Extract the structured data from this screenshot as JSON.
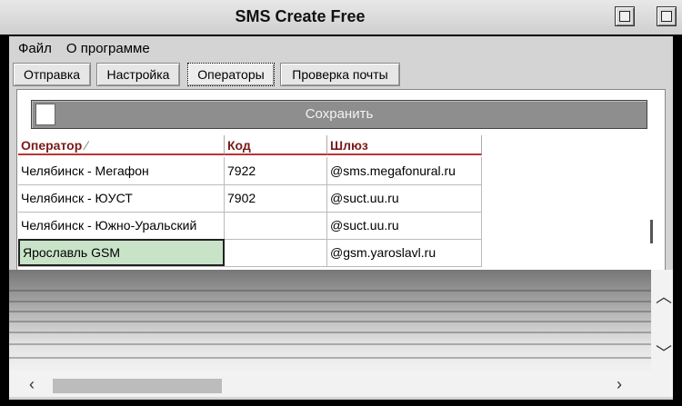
{
  "window": {
    "title": "SMS Create Free"
  },
  "menu": [
    "Файл",
    "О программе"
  ],
  "tabs": [
    {
      "label": "Отправка"
    },
    {
      "label": "Настройка"
    },
    {
      "label": "Операторы",
      "active": true
    },
    {
      "label": "Проверка почты"
    }
  ],
  "save_button": {
    "label": "Сохранить"
  },
  "grid": {
    "columns": [
      "Оператор",
      "Код",
      "Шлюз"
    ],
    "rows": [
      [
        "Челябинск - Мегафон",
        "7922",
        "@sms.megafonural.ru"
      ],
      [
        "Челябинск - ЮУСТ",
        "7902",
        "@suct.uu.ru"
      ],
      [
        "Челябинск - Южно-Уральский",
        "",
        "@suct.uu.ru"
      ],
      [
        "Ярославль GSM",
        "",
        "@gsm.yaroslavl.ru"
      ]
    ]
  },
  "colors": {
    "header_text": "#7a1a1a",
    "edit_cell": "#c9e3c9",
    "save_bar": "#8e8e8e"
  },
  "icons": {
    "sort": "sort-arrow-icon",
    "up": "chevron-up-icon",
    "down": "chevron-down-icon",
    "left": "chevron-left-icon",
    "right": "chevron-right-icon"
  }
}
